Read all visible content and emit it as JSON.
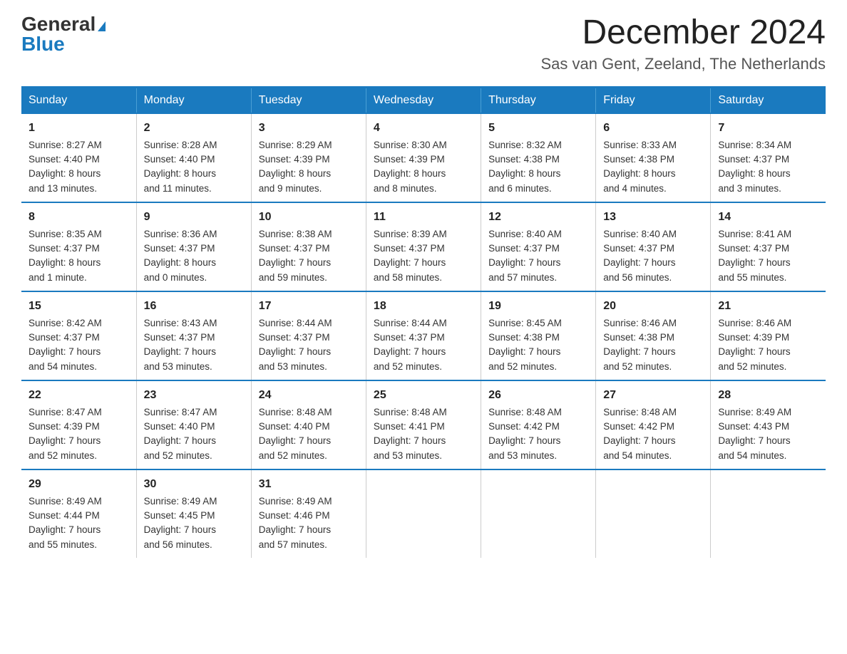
{
  "logo": {
    "general": "General",
    "blue": "Blue",
    "triangle": "▲"
  },
  "header": {
    "month_year": "December 2024",
    "location": "Sas van Gent, Zeeland, The Netherlands"
  },
  "weekdays": [
    "Sunday",
    "Monday",
    "Tuesday",
    "Wednesday",
    "Thursday",
    "Friday",
    "Saturday"
  ],
  "weeks": [
    [
      {
        "day": "1",
        "info": "Sunrise: 8:27 AM\nSunset: 4:40 PM\nDaylight: 8 hours\nand 13 minutes."
      },
      {
        "day": "2",
        "info": "Sunrise: 8:28 AM\nSunset: 4:40 PM\nDaylight: 8 hours\nand 11 minutes."
      },
      {
        "day": "3",
        "info": "Sunrise: 8:29 AM\nSunset: 4:39 PM\nDaylight: 8 hours\nand 9 minutes."
      },
      {
        "day": "4",
        "info": "Sunrise: 8:30 AM\nSunset: 4:39 PM\nDaylight: 8 hours\nand 8 minutes."
      },
      {
        "day": "5",
        "info": "Sunrise: 8:32 AM\nSunset: 4:38 PM\nDaylight: 8 hours\nand 6 minutes."
      },
      {
        "day": "6",
        "info": "Sunrise: 8:33 AM\nSunset: 4:38 PM\nDaylight: 8 hours\nand 4 minutes."
      },
      {
        "day": "7",
        "info": "Sunrise: 8:34 AM\nSunset: 4:37 PM\nDaylight: 8 hours\nand 3 minutes."
      }
    ],
    [
      {
        "day": "8",
        "info": "Sunrise: 8:35 AM\nSunset: 4:37 PM\nDaylight: 8 hours\nand 1 minute."
      },
      {
        "day": "9",
        "info": "Sunrise: 8:36 AM\nSunset: 4:37 PM\nDaylight: 8 hours\nand 0 minutes."
      },
      {
        "day": "10",
        "info": "Sunrise: 8:38 AM\nSunset: 4:37 PM\nDaylight: 7 hours\nand 59 minutes."
      },
      {
        "day": "11",
        "info": "Sunrise: 8:39 AM\nSunset: 4:37 PM\nDaylight: 7 hours\nand 58 minutes."
      },
      {
        "day": "12",
        "info": "Sunrise: 8:40 AM\nSunset: 4:37 PM\nDaylight: 7 hours\nand 57 minutes."
      },
      {
        "day": "13",
        "info": "Sunrise: 8:40 AM\nSunset: 4:37 PM\nDaylight: 7 hours\nand 56 minutes."
      },
      {
        "day": "14",
        "info": "Sunrise: 8:41 AM\nSunset: 4:37 PM\nDaylight: 7 hours\nand 55 minutes."
      }
    ],
    [
      {
        "day": "15",
        "info": "Sunrise: 8:42 AM\nSunset: 4:37 PM\nDaylight: 7 hours\nand 54 minutes."
      },
      {
        "day": "16",
        "info": "Sunrise: 8:43 AM\nSunset: 4:37 PM\nDaylight: 7 hours\nand 53 minutes."
      },
      {
        "day": "17",
        "info": "Sunrise: 8:44 AM\nSunset: 4:37 PM\nDaylight: 7 hours\nand 53 minutes."
      },
      {
        "day": "18",
        "info": "Sunrise: 8:44 AM\nSunset: 4:37 PM\nDaylight: 7 hours\nand 52 minutes."
      },
      {
        "day": "19",
        "info": "Sunrise: 8:45 AM\nSunset: 4:38 PM\nDaylight: 7 hours\nand 52 minutes."
      },
      {
        "day": "20",
        "info": "Sunrise: 8:46 AM\nSunset: 4:38 PM\nDaylight: 7 hours\nand 52 minutes."
      },
      {
        "day": "21",
        "info": "Sunrise: 8:46 AM\nSunset: 4:39 PM\nDaylight: 7 hours\nand 52 minutes."
      }
    ],
    [
      {
        "day": "22",
        "info": "Sunrise: 8:47 AM\nSunset: 4:39 PM\nDaylight: 7 hours\nand 52 minutes."
      },
      {
        "day": "23",
        "info": "Sunrise: 8:47 AM\nSunset: 4:40 PM\nDaylight: 7 hours\nand 52 minutes."
      },
      {
        "day": "24",
        "info": "Sunrise: 8:48 AM\nSunset: 4:40 PM\nDaylight: 7 hours\nand 52 minutes."
      },
      {
        "day": "25",
        "info": "Sunrise: 8:48 AM\nSunset: 4:41 PM\nDaylight: 7 hours\nand 53 minutes."
      },
      {
        "day": "26",
        "info": "Sunrise: 8:48 AM\nSunset: 4:42 PM\nDaylight: 7 hours\nand 53 minutes."
      },
      {
        "day": "27",
        "info": "Sunrise: 8:48 AM\nSunset: 4:42 PM\nDaylight: 7 hours\nand 54 minutes."
      },
      {
        "day": "28",
        "info": "Sunrise: 8:49 AM\nSunset: 4:43 PM\nDaylight: 7 hours\nand 54 minutes."
      }
    ],
    [
      {
        "day": "29",
        "info": "Sunrise: 8:49 AM\nSunset: 4:44 PM\nDaylight: 7 hours\nand 55 minutes."
      },
      {
        "day": "30",
        "info": "Sunrise: 8:49 AM\nSunset: 4:45 PM\nDaylight: 7 hours\nand 56 minutes."
      },
      {
        "day": "31",
        "info": "Sunrise: 8:49 AM\nSunset: 4:46 PM\nDaylight: 7 hours\nand 57 minutes."
      },
      {
        "day": "",
        "info": ""
      },
      {
        "day": "",
        "info": ""
      },
      {
        "day": "",
        "info": ""
      },
      {
        "day": "",
        "info": ""
      }
    ]
  ]
}
